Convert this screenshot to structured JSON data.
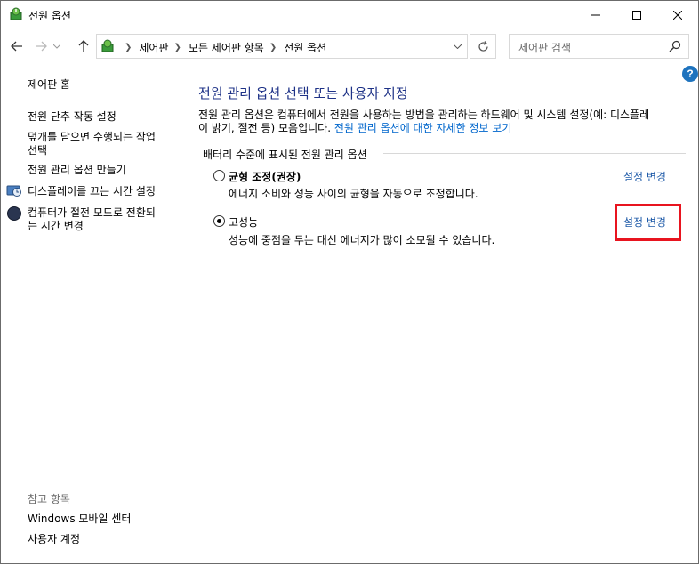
{
  "window": {
    "title": "전원 옵션"
  },
  "address_bar": {
    "breadcrumbs": [
      "제어판",
      "모든 제어판 항목",
      "전원 옵션"
    ],
    "search_placeholder": "제어판 검색"
  },
  "sidebar": {
    "home": "제어판 홈",
    "items": [
      {
        "label": "전원 단추 작동 설정",
        "icon": null
      },
      {
        "label": "덮개를 닫으면 수행되는 작업\n선택",
        "icon": null
      },
      {
        "label": "전원 관리 옵션 만들기",
        "icon": null
      },
      {
        "label": "디스플레이를 끄는 시간 설정",
        "icon": "display-icon"
      },
      {
        "label": "컴퓨터가 절전 모드로 전환되\n는 시간 변경",
        "icon": "sleep-moon-icon"
      }
    ],
    "see_also": {
      "title": "참고 항목",
      "items": [
        "Windows 모바일 센터",
        "사용자 계정"
      ]
    }
  },
  "main": {
    "heading": "전원 관리 옵션 선택 또는 사용자 지정",
    "description": "전원 관리 옵션은 컴퓨터에서 전원을 사용하는 방법을 관리하는 하드웨어 및 시스템 설정(예: 디스플레",
    "description_line2": "이 밝기, 절전 등) 모음입니다. ",
    "description_link": "전원 관리 옵션에 대한 자세한 정보 보기",
    "group_label": "배터리 수준에 표시된 전원 관리 옵션",
    "plans": [
      {
        "name": "균형 조정(권장)",
        "description": "에너지 소비와 성능 사이의 균형을 자동으로 조정합니다.",
        "change_label": "설정 변경",
        "selected": false
      },
      {
        "name": "고성능",
        "description": "성능에 중점을 두는 대신 에너지가 많이 소모될 수 있습니다.",
        "change_label": "설정 변경",
        "selected": true
      }
    ]
  },
  "colors": {
    "heading": "#1e3287",
    "link": "#1e5aa8",
    "highlight": "#e8141f"
  }
}
